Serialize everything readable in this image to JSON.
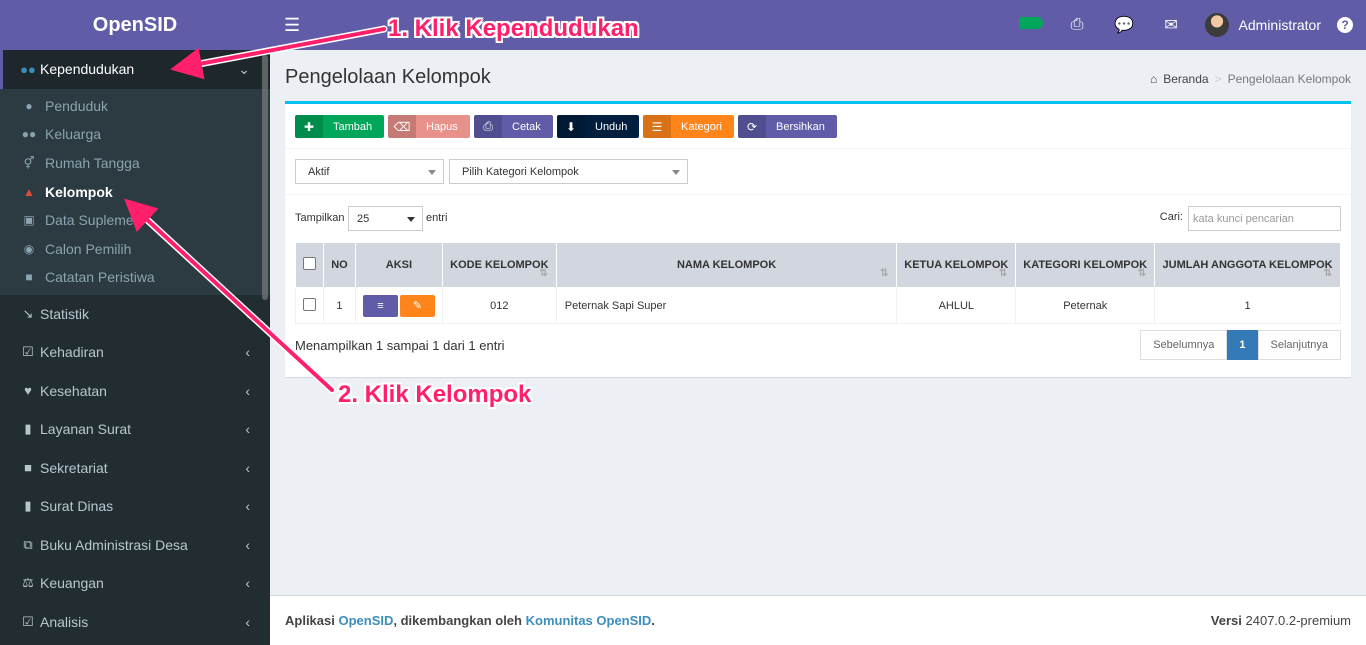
{
  "app": {
    "name": "OpenSID"
  },
  "sidebar": {
    "active": {
      "label": "Kependudukan",
      "icon": "users-icon"
    },
    "submenu": [
      {
        "label": "Penduduk",
        "icon": "user-icon"
      },
      {
        "label": "Keluarga",
        "icon": "users-icon"
      },
      {
        "label": "Rumah Tangga",
        "icon": "venus-mars-icon"
      },
      {
        "label": "Kelompok",
        "icon": "sitemap-icon"
      },
      {
        "label": "Data Suplemen",
        "icon": "slideshare-icon"
      },
      {
        "label": "Calon Pemilih",
        "icon": "dot-circle-icon"
      },
      {
        "label": "Catatan Peristiwa",
        "icon": "archive-icon"
      }
    ],
    "items": [
      {
        "label": "Statistik",
        "icon": "line-chart-icon"
      },
      {
        "label": "Kehadiran",
        "icon": "calendar-check-icon"
      },
      {
        "label": "Kesehatan",
        "icon": "heartbeat-icon"
      },
      {
        "label": "Layanan Surat",
        "icon": "book-icon"
      },
      {
        "label": "Sekretariat",
        "icon": "archive-icon"
      },
      {
        "label": "Surat Dinas",
        "icon": "book-icon"
      },
      {
        "label": "Buku Administrasi Desa",
        "icon": "copy-icon"
      },
      {
        "label": "Keuangan",
        "icon": "balance-scale-icon"
      },
      {
        "label": "Analisis",
        "icon": "check-square-icon"
      }
    ]
  },
  "header": {
    "user": "Administrator"
  },
  "page": {
    "title": "Pengelolaan Kelompok",
    "breadcrumb": {
      "home": "Beranda",
      "current": "Pengelolaan Kelompok"
    }
  },
  "toolbar": {
    "tambah": "Tambah",
    "hapus": "Hapus",
    "cetak": "Cetak",
    "unduh": "Unduh",
    "kategori": "Kategori",
    "bersihkan": "Bersihkan"
  },
  "filters": {
    "status": "Aktif",
    "kategori": "Pilih Kategori Kelompok"
  },
  "table_controls": {
    "show_label": "Tampilkan",
    "show_value": "25",
    "entries_label": "entri",
    "search_label": "Cari:",
    "search_placeholder": "kata kunci pencarian"
  },
  "table": {
    "headers": {
      "no": "NO",
      "aksi": "AKSI",
      "kode": "KODE KELOMPOK",
      "nama": "NAMA KELOMPOK",
      "ketua": "KETUA KELOMPOK",
      "kategori": "KATEGORI KELOMPOK",
      "jumlah": "JUMLAH ANGGOTA KELOMPOK"
    },
    "rows": [
      {
        "no": "1",
        "kode": "012",
        "nama": "Peternak Sapi Super",
        "ketua": "AHLUL",
        "kategori": "Peternak",
        "jumlah": "1"
      }
    ]
  },
  "table_info": "Menampilkan 1 sampai 1 dari 1 entri",
  "pagination": {
    "prev": "Sebelumnya",
    "current": "1",
    "next": "Selanjutnya"
  },
  "footer": {
    "prefix": "Aplikasi",
    "app_link": "OpenSID",
    "middle": ", dikembangkan oleh",
    "community_link": "Komunitas OpenSID",
    "suffix": ".",
    "version_label": "Versi",
    "version": "2407.0.2-premium"
  },
  "annotations": {
    "step1": "1. Klik Kependudukan",
    "step2": "2. Klik Kelompok"
  },
  "colors": {
    "purple": "#605ca8",
    "sidebar": "#222d32",
    "accent": "#ff1f6a",
    "green": "#00a65a",
    "orange": "#ff851b"
  }
}
